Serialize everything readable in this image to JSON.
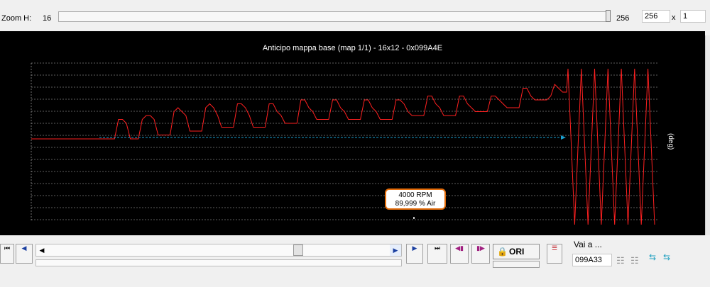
{
  "zoom": {
    "label": "Zoom H:",
    "value": "16",
    "max": "256",
    "box": "256",
    "x": "x",
    "multiplier": "1"
  },
  "chart_data": {
    "type": "line",
    "title": "Anticipo mappa base (map 1/1) - 16x12 - 0x099A4E",
    "ylabel": "(deg)",
    "grid": true,
    "series": [
      {
        "color": "#ff2020",
        "values": [
          0,
          0,
          0,
          0,
          0,
          0,
          0,
          0,
          0,
          0,
          0,
          0,
          0,
          0,
          0,
          0,
          0,
          0,
          0,
          0,
          0,
          0,
          5,
          5,
          4,
          0,
          0,
          0,
          5,
          6,
          6,
          5,
          1,
          1,
          1,
          1,
          7,
          8,
          7,
          6,
          2,
          2,
          2,
          2,
          8,
          9,
          8,
          6,
          3,
          3,
          3,
          3,
          9,
          9,
          8,
          6,
          3,
          3,
          3,
          3,
          9,
          9,
          7,
          6,
          4,
          4,
          4,
          4,
          10,
          10,
          8,
          7,
          5,
          5,
          5,
          5,
          10,
          10,
          8,
          7,
          5,
          5,
          5,
          5,
          10,
          10,
          8,
          7,
          5,
          5,
          5,
          5,
          10,
          10,
          9,
          7,
          6,
          6,
          6,
          6,
          11,
          11,
          9,
          8,
          6,
          6,
          6,
          6,
          11,
          11,
          9,
          8,
          7,
          7,
          7,
          7,
          11,
          11,
          10,
          9,
          8,
          8,
          8,
          8,
          13,
          13,
          11,
          10,
          10,
          10,
          10,
          11,
          14,
          13,
          12,
          12
        ]
      },
      {
        "color": "#1aa0d0",
        "values": [
          0,
          0,
          0,
          0,
          0,
          0
        ]
      }
    ],
    "oscillation_values": [
      18,
      -22,
      18,
      -22,
      18,
      -22,
      18,
      -22,
      18,
      -22,
      18,
      -22,
      18,
      -22
    ],
    "cursor": {
      "rpm": "4000 RPM",
      "air": "89,999 % Air"
    }
  },
  "bottom": {
    "ori_label": "ORI",
    "vai_label": "Vai a ...",
    "address": "099A33"
  }
}
